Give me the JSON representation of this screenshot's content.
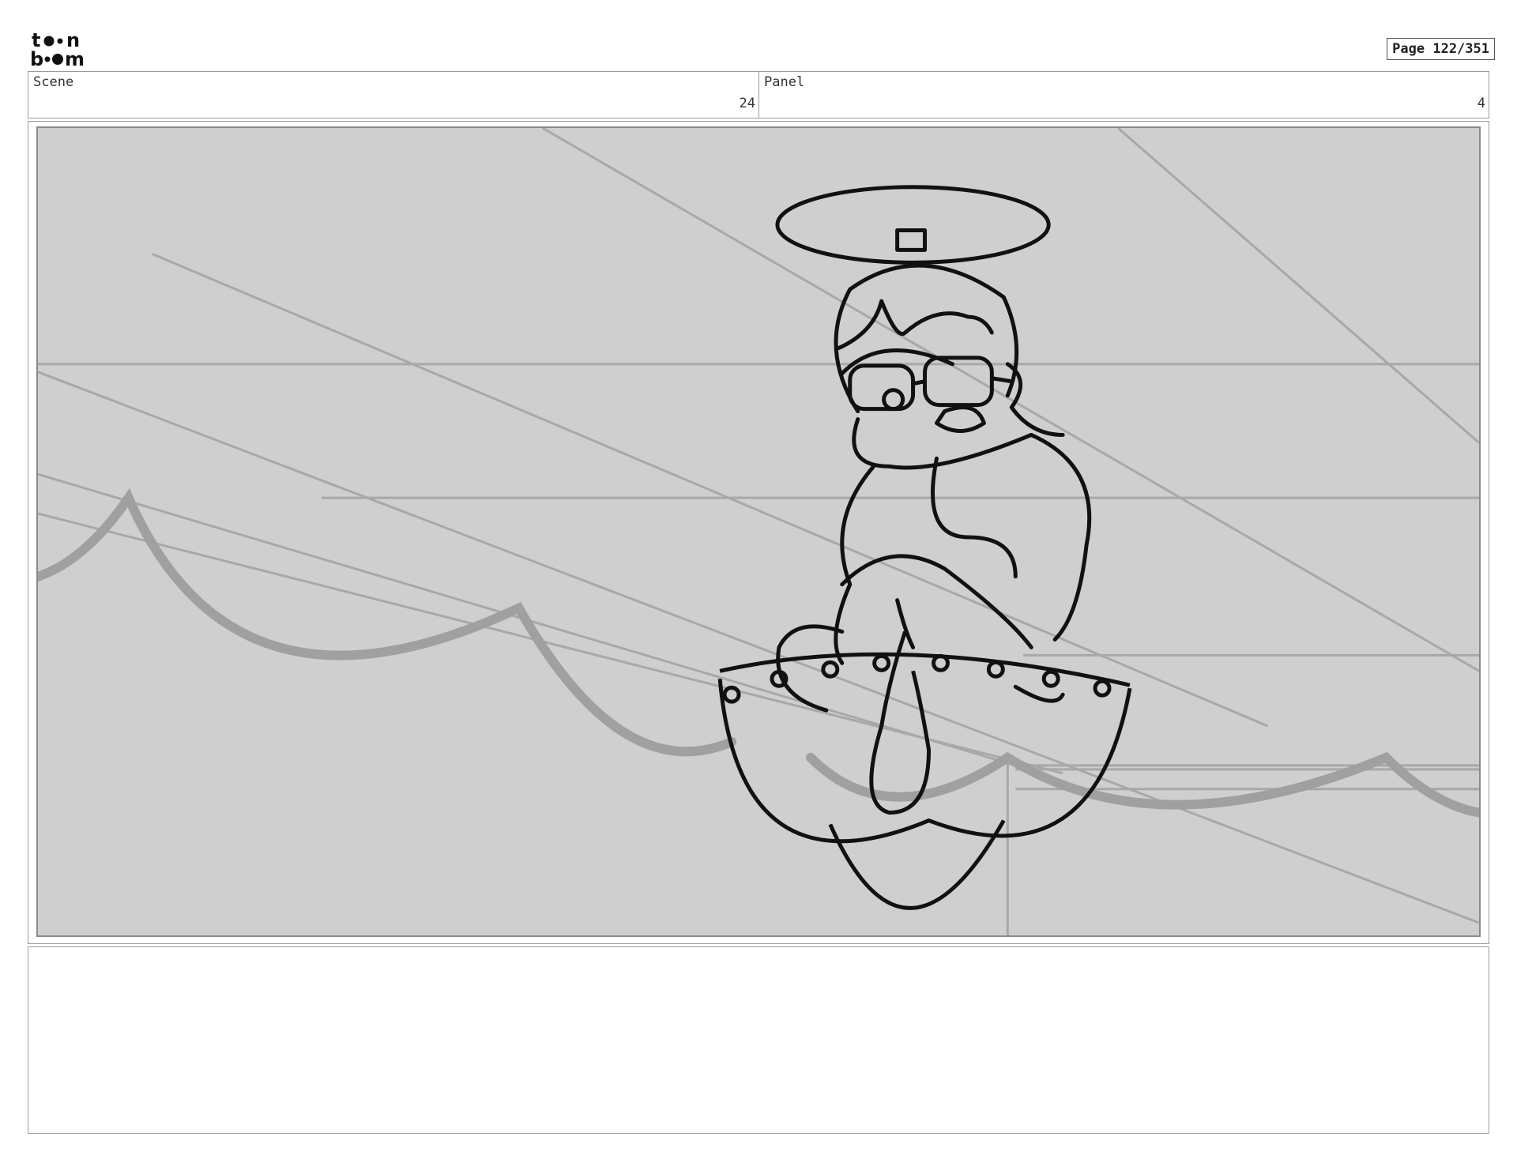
{
  "logo": {
    "text": "toonboom",
    "icon": "toonboom-logo"
  },
  "page_indicator": "Page 122/351",
  "scene": {
    "label": "Scene",
    "value": "24"
  },
  "panel": {
    "label": "Panel",
    "value": "4"
  },
  "drawing": {
    "description_icon": "storyboard-sketch",
    "background_color": "#cfcfcf",
    "line_color": "#111111",
    "guide_color": "#9a9a9a"
  },
  "notes": {
    "text": ""
  }
}
